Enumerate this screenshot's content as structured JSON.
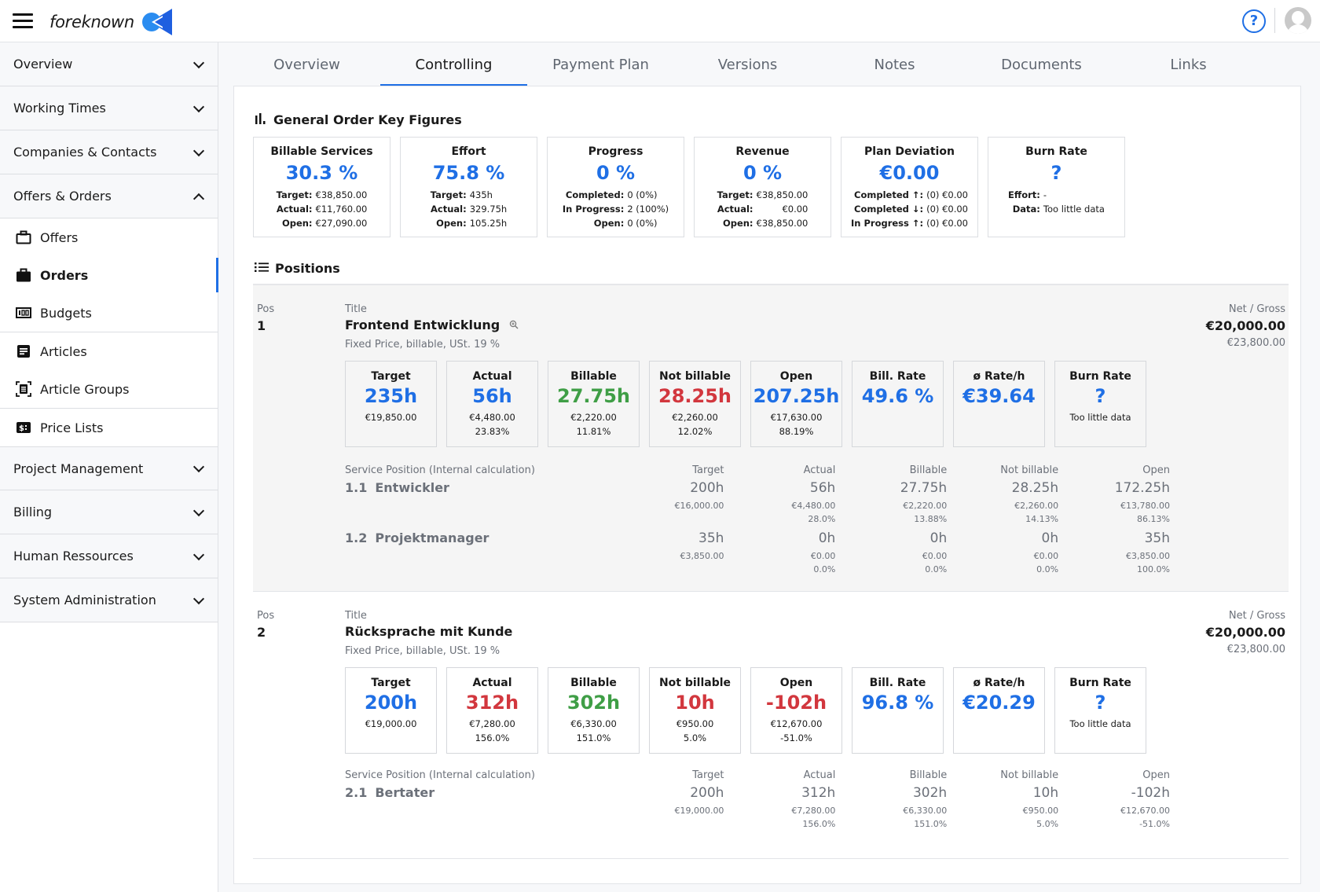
{
  "header": {
    "brand": "foreknown",
    "help_label": "?",
    "icons": [
      "menu-icon",
      "help-icon",
      "user-avatar-icon"
    ]
  },
  "sidebar": {
    "sections_top": [
      {
        "label": "Overview",
        "expanded": false
      },
      {
        "label": "Working Times",
        "expanded": false
      },
      {
        "label": "Companies & Contacts",
        "expanded": false
      },
      {
        "label": "Offers & Orders",
        "expanded": true
      }
    ],
    "sub_items": [
      {
        "label": "Offers",
        "icon": "briefcase-outline-icon"
      },
      {
        "label": "Orders",
        "icon": "briefcase-filled-icon",
        "active": true
      },
      {
        "label": "Budgets",
        "icon": "budget-counter-icon"
      },
      {
        "label": "Articles",
        "icon": "article-icon"
      },
      {
        "label": "Article Groups",
        "icon": "article-group-icon"
      },
      {
        "label": "Price Lists",
        "icon": "price-list-icon"
      }
    ],
    "sections_bottom": [
      {
        "label": "Project Management",
        "expanded": false
      },
      {
        "label": "Billing",
        "expanded": false
      },
      {
        "label": "Human Ressources",
        "expanded": false
      },
      {
        "label": "System Administration",
        "expanded": false
      }
    ]
  },
  "tabs": [
    {
      "label": "Overview"
    },
    {
      "label": "Controlling",
      "active": true
    },
    {
      "label": "Payment Plan"
    },
    {
      "label": "Versions"
    },
    {
      "label": "Notes"
    },
    {
      "label": "Documents"
    },
    {
      "label": "Links"
    }
  ],
  "key_figures": {
    "title": "General Order Key Figures",
    "cards": [
      {
        "title": "Billable Services",
        "value": "30.3 %",
        "rows": [
          [
            "Target:",
            "€38,850.00"
          ],
          [
            "Actual:",
            "€11,760.00"
          ],
          [
            "Open:",
            "€27,090.00"
          ]
        ]
      },
      {
        "title": "Effort",
        "value": "75.8 %",
        "rows": [
          [
            "Target:",
            "435h"
          ],
          [
            "Actual:",
            "329.75h"
          ],
          [
            "Open:",
            "105.25h"
          ]
        ]
      },
      {
        "title": "Progress",
        "value": "0 %",
        "rows": [
          [
            "Completed:",
            "0 (0%)"
          ],
          [
            "In Progress:",
            "2 (100%)"
          ],
          [
            "Open:",
            "0 (0%)"
          ]
        ]
      },
      {
        "title": "Revenue",
        "value": "0 %",
        "rows": [
          [
            "Target:",
            "€38,850.00"
          ],
          [
            "Actual:",
            "€0.00"
          ],
          [
            "Open:",
            "€38,850.00"
          ]
        ]
      },
      {
        "title": "Plan Deviation",
        "value": "€0.00",
        "rows": [
          [
            "Completed ↑:",
            "(0) €0.00"
          ],
          [
            "Completed ↓:",
            "(0) €0.00"
          ],
          [
            "In Progress ↑:",
            "(0) €0.00"
          ]
        ]
      },
      {
        "title": "Burn Rate",
        "value": "?",
        "rows": [
          [
            "Effort:",
            "-"
          ],
          [
            "Data:",
            "Too little data"
          ]
        ]
      }
    ]
  },
  "positions": {
    "title": "Positions",
    "labels": {
      "pos": "Pos",
      "title": "Title",
      "net_gross": "Net / Gross",
      "service_position": "Service Position (Internal calculation)",
      "cols": [
        "Target",
        "Actual",
        "Billable",
        "Not billable",
        "Open"
      ]
    },
    "items": [
      {
        "pos": "1",
        "title": "Frontend Entwicklung",
        "subtitle": "Fixed Price, billable, USt. 19 %",
        "net": "€20,000.00",
        "gross": "€23,800.00",
        "metrics": [
          {
            "title": "Target",
            "value": "235h",
            "color": "#1f6fe5",
            "lines": [
              "€19,850.00"
            ]
          },
          {
            "title": "Actual",
            "value": "56h",
            "color": "#1f6fe5",
            "lines": [
              "€4,480.00",
              "23.83%"
            ]
          },
          {
            "title": "Billable",
            "value": "27.75h",
            "color": "#3f9e46",
            "lines": [
              "€2,220.00",
              "11.81%"
            ]
          },
          {
            "title": "Not billable",
            "value": "28.25h",
            "color": "#d2373e",
            "lines": [
              "€2,260.00",
              "12.02%"
            ]
          },
          {
            "title": "Open",
            "value": "207.25h",
            "color": "#1f6fe5",
            "lines": [
              "€17,630.00",
              "88.19%"
            ]
          },
          {
            "title": "Bill. Rate",
            "value": "49.6 %",
            "color": "#1f6fe5",
            "lines": []
          },
          {
            "title": "ø Rate/h",
            "value": "€39.64",
            "color": "#1f6fe5",
            "lines": []
          },
          {
            "title": "Burn Rate",
            "value": "?",
            "color": "#1f6fe5",
            "lines": [
              "Too little data"
            ]
          }
        ],
        "service_positions": [
          {
            "num": "1.1",
            "name": "Entwickler",
            "cols": [
              {
                "h": "200h",
                "eur": "€16,000.00",
                "pct": ""
              },
              {
                "h": "56h",
                "eur": "€4,480.00",
                "pct": "28.0%"
              },
              {
                "h": "27.75h",
                "eur": "€2,220.00",
                "pct": "13.88%"
              },
              {
                "h": "28.25h",
                "eur": "€2,260.00",
                "pct": "14.13%"
              },
              {
                "h": "172.25h",
                "eur": "€13,780.00",
                "pct": "86.13%"
              }
            ]
          },
          {
            "num": "1.2",
            "name": "Projektmanager",
            "cols": [
              {
                "h": "35h",
                "eur": "€3,850.00",
                "pct": ""
              },
              {
                "h": "0h",
                "eur": "€0.00",
                "pct": "0.0%"
              },
              {
                "h": "0h",
                "eur": "€0.00",
                "pct": "0.0%"
              },
              {
                "h": "0h",
                "eur": "€0.00",
                "pct": "0.0%"
              },
              {
                "h": "35h",
                "eur": "€3,850.00",
                "pct": "100.0%"
              }
            ]
          }
        ]
      },
      {
        "pos": "2",
        "title": "Rücksprache mit Kunde",
        "subtitle": "Fixed Price, billable, USt. 19 %",
        "net": "€20,000.00",
        "gross": "€23,800.00",
        "metrics": [
          {
            "title": "Target",
            "value": "200h",
            "color": "#1f6fe5",
            "lines": [
              "€19,000.00"
            ]
          },
          {
            "title": "Actual",
            "value": "312h",
            "color": "#d2373e",
            "lines": [
              "€7,280.00",
              "156.0%"
            ]
          },
          {
            "title": "Billable",
            "value": "302h",
            "color": "#3f9e46",
            "lines": [
              "€6,330.00",
              "151.0%"
            ]
          },
          {
            "title": "Not billable",
            "value": "10h",
            "color": "#d2373e",
            "lines": [
              "€950.00",
              "5.0%"
            ]
          },
          {
            "title": "Open",
            "value": "-102h",
            "color": "#d2373e",
            "lines": [
              "€12,670.00",
              "-51.0%"
            ]
          },
          {
            "title": "Bill. Rate",
            "value": "96.8 %",
            "color": "#1f6fe5",
            "lines": []
          },
          {
            "title": "ø Rate/h",
            "value": "€20.29",
            "color": "#1f6fe5",
            "lines": []
          },
          {
            "title": "Burn Rate",
            "value": "?",
            "color": "#1f6fe5",
            "lines": [
              "Too little data"
            ]
          }
        ],
        "service_positions": [
          {
            "num": "2.1",
            "name": "Bertater",
            "cols": [
              {
                "h": "200h",
                "eur": "€19,000.00",
                "pct": ""
              },
              {
                "h": "312h",
                "eur": "€7,280.00",
                "pct": "156.0%"
              },
              {
                "h": "302h",
                "eur": "€6,330.00",
                "pct": "151.0%"
              },
              {
                "h": "10h",
                "eur": "€950.00",
                "pct": "5.0%"
              },
              {
                "h": "-102h",
                "eur": "€12,670.00",
                "pct": "-51.0%"
              }
            ]
          }
        ]
      }
    ]
  },
  "colors": {
    "accent": "#1f6fe5",
    "positive": "#3f9e46",
    "negative": "#d2373e"
  }
}
